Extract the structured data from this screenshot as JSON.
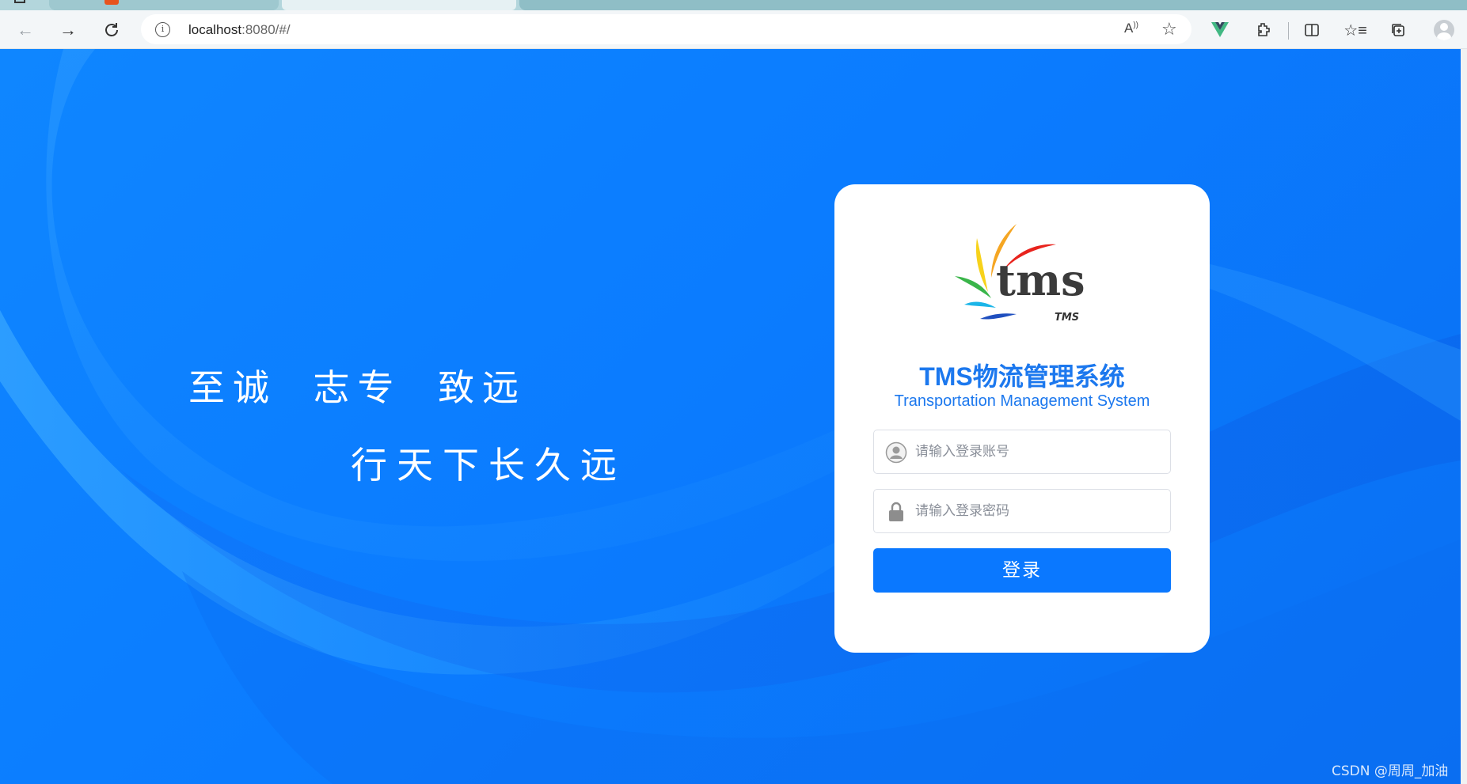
{
  "browser": {
    "url_host": "localhost",
    "url_rest": ":8080/#/",
    "icons": [
      "back-icon",
      "forward-icon",
      "reload-icon",
      "info-icon",
      "read-aloud-icon",
      "add-favorite-icon",
      "vue-devtools-icon",
      "extensions-icon",
      "split-screen-icon",
      "favorites-icon",
      "collections-icon",
      "profile-icon"
    ]
  },
  "slogan": {
    "line1": "至诚  志专  致远",
    "line2": "行天下长久远"
  },
  "login": {
    "logo_text": "tms",
    "logo_small": "TMS",
    "title": "TMS物流管理系统",
    "subtitle": "Transportation Management System",
    "username_placeholder": "请输入登录账号",
    "password_placeholder": "请输入登录密码",
    "submit_label": "登录"
  },
  "watermark": "CSDN @周周_加油",
  "colors": {
    "page_bg": "#0a78ff",
    "accent": "#1c78ee",
    "button": "#0a78ff"
  }
}
